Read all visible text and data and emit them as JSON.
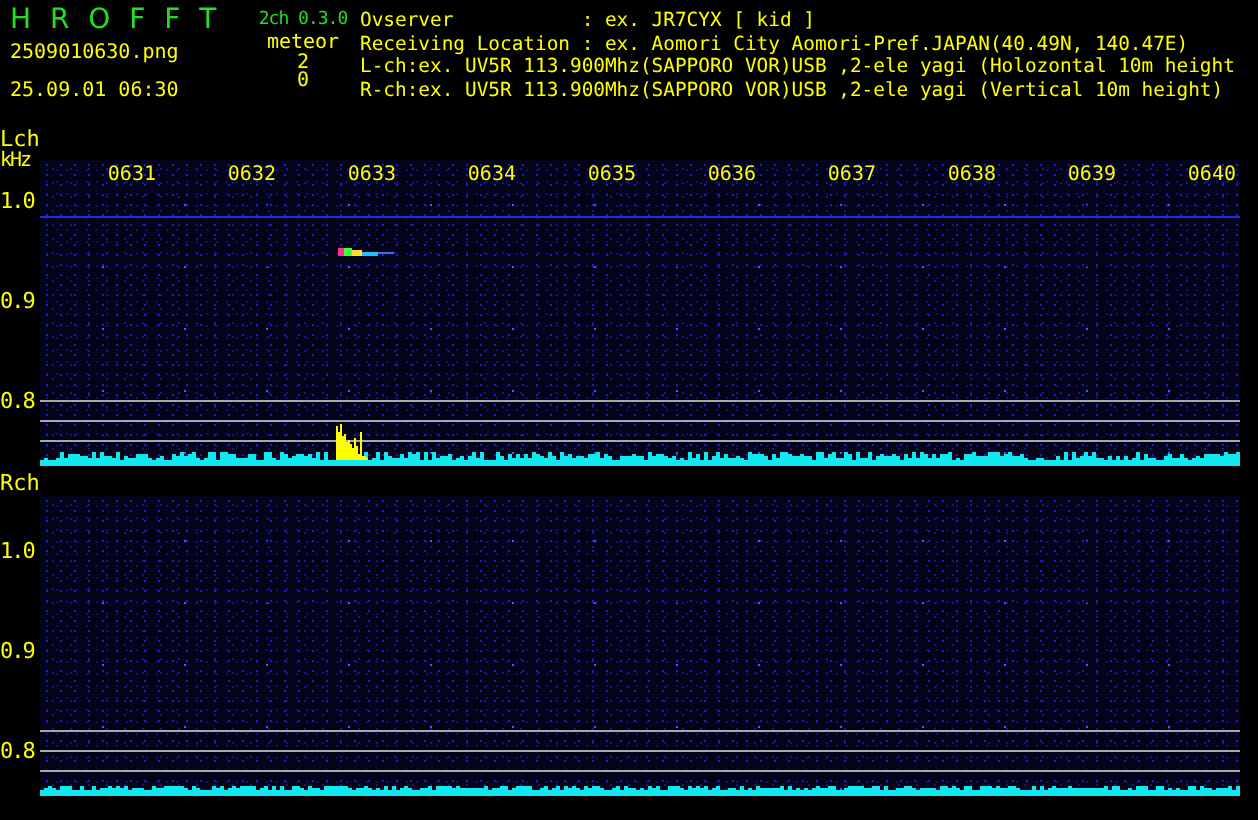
{
  "app": {
    "name": "H R O F F T",
    "version": "2ch 0.3.0",
    "file": "2509010630.png",
    "timestamp": "25.09.01 06:30",
    "mode": "meteor",
    "counts": [
      "2",
      "0"
    ]
  },
  "info": [
    "Ovserver           : ex. JR7CYX [ kid ]",
    "Receiving Location : ex. Aomori City Aomori-Pref.JAPAN(40.49N, 140.47E)",
    "L-ch:ex. UV5R 113.900Mhz(SAPPORO VOR)USB ,2-ele yagi (Holozontal 10m height",
    "R-ch:ex. UV5R 113.900Mhz(SAPPORO VOR)USB ,2-ele yagi (Vertical 10m height)"
  ],
  "channels": [
    {
      "label": "Lch",
      "unit": "kHz",
      "ticks": [
        "1.0",
        "0.9",
        "0.8"
      ],
      "times": [
        "0631",
        "0632",
        "0633",
        "0634",
        "0635",
        "0636",
        "0637",
        "0638",
        "0639",
        "0640"
      ],
      "meteor_echo": true
    },
    {
      "label": "Rch",
      "ticks": [
        "1.0",
        "0.9",
        "0.8"
      ],
      "meteor_echo": false
    }
  ]
}
